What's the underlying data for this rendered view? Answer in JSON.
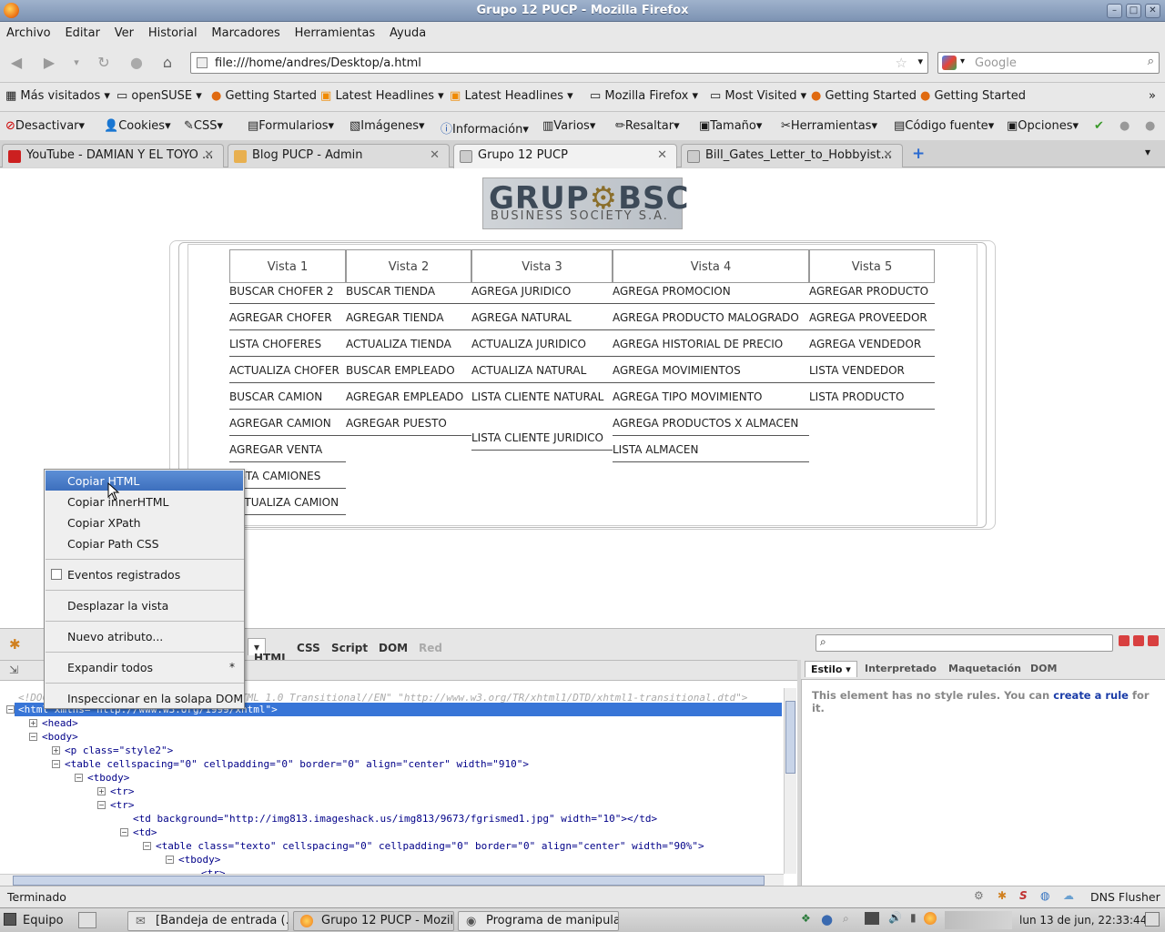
{
  "window": {
    "title": "Grupo 12 PUCP - Mozilla Firefox"
  },
  "menubar": [
    "Archivo",
    "Editar",
    "Ver",
    "Historial",
    "Marcadores",
    "Herramientas",
    "Ayuda"
  ],
  "navbar": {
    "url": "file:///home/andres/Desktop/a.html",
    "search_placeholder": "Google"
  },
  "bookmarks": [
    "Más visitados",
    "openSUSE",
    "Getting Started",
    "Latest Headlines",
    "Latest Headlines",
    "Mozilla Firefox",
    "Most Visited",
    "Getting Started",
    "Getting Started"
  ],
  "devtoolbar": [
    "Desactivar",
    "Cookies",
    "CSS",
    "Formularios",
    "Imágenes",
    "Información",
    "Varios",
    "Resaltar",
    "Tamaño",
    "Herramientas",
    "Código fuente",
    "Opciones"
  ],
  "tabs": [
    {
      "label": "YouTube - DAMIAN Y EL TOYO ..."
    },
    {
      "label": "Blog PUCP - Admin"
    },
    {
      "label": "Grupo 12 PUCP"
    },
    {
      "label": "Bill_Gates_Letter_to_Hobbyist..."
    }
  ],
  "logo": {
    "line1": "GRUP",
    "line1b": "BSC",
    "line2": "BUSINESS SOCIETY S.A."
  },
  "views": {
    "headers": [
      "Vista 1",
      "Vista 2",
      "Vista 3",
      "Vista 4",
      "Vista 5"
    ],
    "col1": [
      "BUSCAR CHOFER 2",
      "AGREGAR CHOFER",
      "LISTA CHOFERES",
      "ACTUALIZA CHOFER",
      "BUSCAR CAMION",
      "AGREGAR CAMION",
      "AGREGAR VENTA",
      "LISTA CAMIONES",
      "ACTUALIZA CAMION"
    ],
    "col2": [
      "BUSCAR TIENDA",
      "AGREGAR TIENDA",
      "ACTUALIZA TIENDA",
      "BUSCAR EMPLEADO",
      "AGREGAR EMPLEADO",
      "AGREGAR PUESTO"
    ],
    "col3": [
      "AGREGA JURIDICO",
      "AGREGA NATURAL",
      "ACTUALIZA JURIDICO",
      "ACTUALIZA NATURAL",
      "LISTA CLIENTE NATURAL",
      "LISTA CLIENTE JURIDICO"
    ],
    "col4": [
      "AGREGA PROMOCION",
      "AGREGA PRODUCTO MALOGRADO",
      "AGREGA HISTORIAL DE PRECIO",
      "AGREGA MOVIMIENTOS",
      "AGREGA TIPO MOVIMIENTO",
      "AGREGA PRODUCTOS X ALMACEN",
      "LISTA ALMACEN"
    ],
    "col5": [
      "AGREGAR PRODUCTO",
      "AGREGA PROVEEDOR",
      "AGREGA VENDEDOR",
      "LISTA VENDEDOR",
      "LISTA PRODUCTO"
    ]
  },
  "context_menu": {
    "copy_html": "Copiar HTML",
    "copy_inner": "Copiar innerHTML",
    "copy_xpath": "Copiar XPath",
    "copy_css": "Copiar Path CSS",
    "events": "Eventos registrados",
    "scroll": "Desplazar la vista",
    "new_attr": "Nuevo atributo...",
    "expand": "Expandir todos",
    "expand_shortcut": "*",
    "inspect_dom": "Inspeccionar en la solapa DOM"
  },
  "firebug": {
    "tabs": [
      "HTML",
      "CSS",
      "Script",
      "DOM",
      "Red"
    ],
    "side_tabs": [
      "Estilo",
      "Interpretado",
      "Maquetación",
      "DOM"
    ],
    "side_msg": "This element has no style rules. You can",
    "side_link": "create a rule",
    "side_msg2": "for it.",
    "doctype": "<!DOCTYPE html PUBLIC \"-//W3C//DTD XHTML 1.0 Transitional//EN\" \"http://www.w3.org/TR/xhtml1/DTD/xhtml1-transitional.dtd\">",
    "html_line": "<html xmlns=\"http://www.w3.org/1999/xhtml\">",
    "lines": {
      "head": "<head>",
      "body": "<body>",
      "p": "<p class=\"style2\">",
      "table": "<table cellspacing=\"0\" cellpadding=\"0\" border=\"0\" align=\"center\" width=\"910\">",
      "tbody": "<tbody>",
      "tr1": "<tr>",
      "tr2": "<tr>",
      "td_bg": "<td background=\"http://img813.imageshack.us/img813/9673/fgrismed1.jpg\" width=\"10\"></td>",
      "td": "<td>",
      "table2": "<table class=\"texto\" cellspacing=\"0\" cellpadding=\"0\" border=\"0\" align=\"center\" width=\"90%\">",
      "tbody2": "<tbody>",
      "tr3": "<tr>"
    }
  },
  "status": {
    "text": "Terminado",
    "addon": "DNS Flusher"
  },
  "taskbar": {
    "start": "Equipo",
    "items": [
      "[Bandeja de entrada (...",
      "Grupo 12 PUCP - Mozil...",
      "Programa de manipula..."
    ],
    "clock": "lun 13 de jun, 22:33:44"
  }
}
